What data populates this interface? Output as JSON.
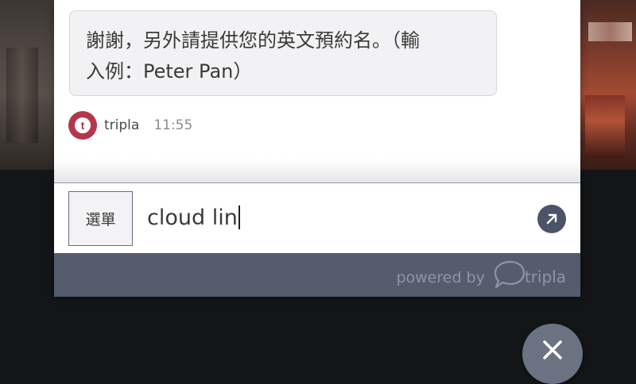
{
  "message": {
    "text": "謝謝，另外請提供您的英文預約名。（輸入例：Peter Pan）",
    "line1": "謝謝，另外請提供您的英文預約名。（輸",
    "line2": "入例：Peter Pan）",
    "sender": "tripla",
    "time": "11:55"
  },
  "input_bar": {
    "menu_label": "選單",
    "input_value": "cloud lin",
    "send_icon": "arrow-up-right-icon"
  },
  "footer": {
    "powered_by": "powered by",
    "brand": "tripla"
  },
  "colors": {
    "accent": "#b3374c",
    "footer_bg": "#545c6e",
    "send_button": "#4b5466"
  }
}
